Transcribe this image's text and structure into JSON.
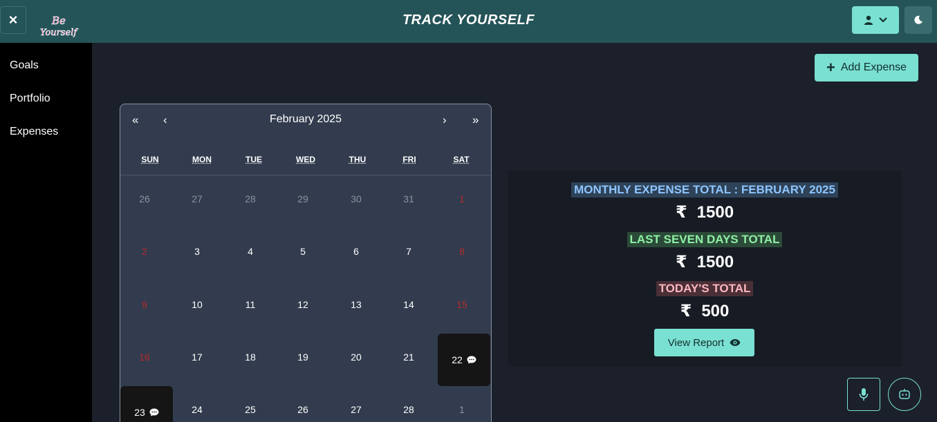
{
  "header": {
    "close_label": "×",
    "logo_text_1": "Be",
    "logo_text_2": "Yourself",
    "title": "TRACK YOURSELF",
    "user_icon": "user-icon",
    "theme_icon": "moon-icon"
  },
  "sidebar": {
    "items": [
      {
        "label": "Goals"
      },
      {
        "label": "Portfolio"
      },
      {
        "label": "Expenses"
      }
    ]
  },
  "toolbar": {
    "add_expense_label": "Add Expense"
  },
  "calendar": {
    "nav_first": "«",
    "nav_prev": "‹",
    "title": "February 2025",
    "nav_next": "›",
    "nav_last": "»",
    "weekdays": [
      "SUN",
      "MON",
      "TUE",
      "WED",
      "THU",
      "FRI",
      "SAT"
    ],
    "weeks": [
      [
        "26",
        "27",
        "28",
        "29",
        "30",
        "31",
        "1"
      ],
      [
        "2",
        "3",
        "4",
        "5",
        "6",
        "7",
        "8"
      ],
      [
        "9",
        "10",
        "11",
        "12",
        "13",
        "14",
        "15"
      ],
      [
        "16",
        "17",
        "18",
        "19",
        "20",
        "21",
        "22"
      ],
      [
        "23",
        "24",
        "25",
        "26",
        "27",
        "28",
        "1"
      ]
    ]
  },
  "summary": {
    "monthly_label": "MONTHLY EXPENSE TOTAL : FEBRUARY 2025",
    "monthly_amount": "1500",
    "seven_days_label": "LAST SEVEN DAYS TOTAL",
    "seven_days_amount": "1500",
    "today_label": "TODAY'S TOTAL",
    "today_amount": "500",
    "currency_symbol": "₹",
    "view_report_label": "View Report"
  },
  "colors": {
    "accent": "#7ae0d2",
    "header_bg": "#255458",
    "page_bg": "#1b202b",
    "weekend_red": "#b52a2a"
  }
}
